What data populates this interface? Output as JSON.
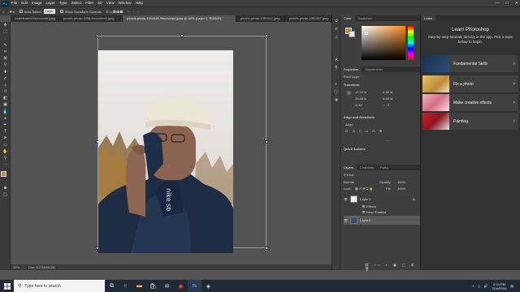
{
  "app": {
    "logo": "Ps"
  },
  "menu": [
    "File",
    "Edit",
    "Image",
    "Layer",
    "Type",
    "Select",
    "Filter",
    "3D",
    "View",
    "Window",
    "Help"
  ],
  "window_controls": {
    "minimize": "—",
    "maximize": "□",
    "close": "✕"
  },
  "options_bar": {
    "auto_select_label": "Auto-Select:",
    "auto_select_value": "Layer",
    "transform_controls_label": "Show Transform Controls"
  },
  "doc_tabs": [
    {
      "label": "Undefeated-Recovered.jpeg"
    },
    {
      "label": "pexels-photo-1048-Recovered.jpeg"
    },
    {
      "label": "pexels-photo-1210441-Recovered.jpeg @ 34% (Layer 0, RGB/8*)"
    },
    {
      "label": "pexels-photo-1391442.jpeg"
    },
    {
      "label": "pexels-photo-1051287.jpeg"
    }
  ],
  "status": {
    "zoom": "34%",
    "doc_info": "Doc: 5.27M/15.2M"
  },
  "color_panel": {
    "tab_color": "Color",
    "tab_swatches": "Swatches"
  },
  "properties_panel": {
    "tab_properties": "Properties",
    "tab_adjustments": "Adjustments",
    "kind": "Pixel Layer",
    "transform_label": "Transform",
    "w_value": "17.92 in",
    "h_value": "26.88 in",
    "x_value": "0.48 in",
    "y_value": "0.53 in",
    "angle_value": "0.00°",
    "align_label": "Align and Distribute",
    "align_sub": "Align:",
    "quick_actions_label": "Quick Actions"
  },
  "layers_panel": {
    "tab_layers": "Layers",
    "tab_channels": "Channels",
    "tab_paths": "Paths",
    "kind_filter": "Kind",
    "blend_mode": "Normal",
    "opacity_label": "Opacity:",
    "opacity_value": "100%",
    "lock_label": "Lock:",
    "fill_label": "Fill:",
    "fill_value": "100%",
    "layers": [
      {
        "name": "Layer 1",
        "fx": "fx"
      },
      {
        "name": "Effects"
      },
      {
        "name": "Drop Shadow"
      },
      {
        "name": "Layer 0"
      }
    ]
  },
  "learn_panel": {
    "tab": "Learn",
    "title": "Learn Photoshop",
    "subtitle": "Step-by-step tutorials directly in the app. Pick a topic below to begin.",
    "cards": [
      {
        "label": "Fundamental Skills"
      },
      {
        "label": "Fix a photo"
      },
      {
        "label": "Make creative effects"
      },
      {
        "label": "Painting"
      }
    ],
    "chevron": "›"
  },
  "taskbar": {
    "search_placeholder": "Type here to search",
    "time": "2:14 PM",
    "date": "11/4/2018"
  },
  "colors": {
    "accent": "#31a8ff",
    "foreground_swatch": "#b58a55",
    "background_swatch": "#e6e6e6"
  }
}
